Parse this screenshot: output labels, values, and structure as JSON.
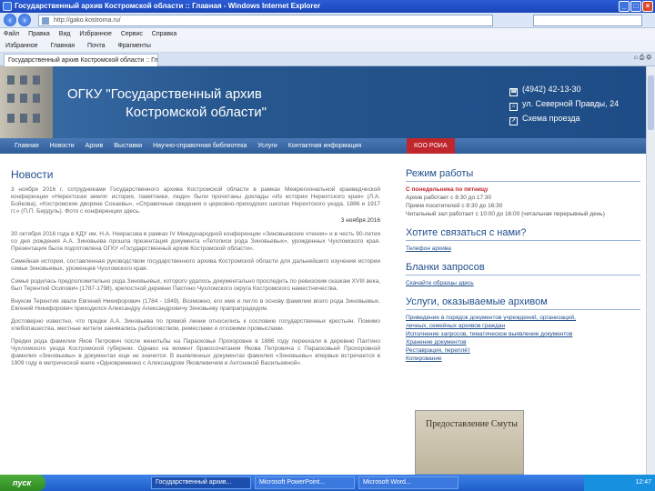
{
  "window": {
    "title": "Государственный архив Костромской области :: Главная - Windows Internet Explorer"
  },
  "address": {
    "url": "http://gako.kostroma.ru/"
  },
  "menu": [
    "Файл",
    "Правка",
    "Вид",
    "Избранное",
    "Сервис",
    "Справка"
  ],
  "favorites": [
    "Избранное",
    "Главная",
    "Почта",
    "Фрагменты"
  ],
  "tab": {
    "label": "Государственный архив Костромской области :: Гл..."
  },
  "site": {
    "title_line1": "ОГКУ \"Государственный архив",
    "title_line2": "Костромской области\"",
    "phone": "(4942) 42-13-30",
    "address": "ул. Северной Правды, 24",
    "map": "Схема проезда"
  },
  "nav": [
    "Главная",
    "Новости",
    "Архив",
    "Выставки",
    "Научно-справочная библиотека",
    "Услуги",
    "Контактная информация"
  ],
  "nav_special": "КОО РОИА",
  "news": {
    "heading": "Новости",
    "item1": "3 ноября 2016 г. сотрудниками Государственного архива Костромской области в рамках Межрегиональной краеведческой конференции «Нерехтская земля: история, памятники, люди» были прочитаны доклады «Из истории Нерехтского края» (Л.А. Бойкова), «Костромские дворяне Сокаевы», «Справочные сведения о церковно-приходских школах Нерехтского уезда. 1886 и 1917 гг.» (П.П. Бердуль). Фото с конференции здесь.",
    "date1": "3 ноября 2016",
    "item2": "30 октября 2016 года в КДУ им. Н.А. Некрасова в рамках IV Международной конференции «Зиновьевские чтения» и в честь 90-летия со дня рождения А.А. Зиновьева прошла презентация документа «Летописи рода Зиновьевых», урожденных Чухломского края. Презентация была подготовлена ОГКУ «Государственный архив Костромской области».",
    "item3": "Семейная история, составленная руководством государственного архива Костромской области для дальнейшего изучения истории семьи Зиновьевых, уроженцев Чухломского края.",
    "item4": "Семья родилась предположительно рода Зиновьевых, которого удалось документально проследить по ревизским сказкам XVIII века, был Терентий Осипович (1787-1798), крепостной деревни Пахтино Чухломского округа Костромского наместничества.",
    "item5": "Внуком Терентия звали Евгений Никифорович (1784 - 1849). Возможно, его имя и легло в основу фамилии всего рода Зиновьевых. Евгений Никифорович приходился Александру Александровичу Зиновьеву прапрапрадедом.",
    "item6": "Достоверно известно, что предки А.А. Зиновьева по прямой линии относились к сословию государственных крестьян. Помимо хлебопашества, местные жители занимались рыболовством, ремеслами и отхожими промыслами.",
    "item7": "Предки рода фамилии Яков Петрович после женитьбы на Парасковье Прохоровне в 1886 году переехали в деревню Пахтино Чухломского уезда Костромской губернии. Однако на момент бракосочетания Якова Петровича с Парасковьей Прохоровной фамилия «Зиновьевы» в документах еще не значится. В выявленных документах фамилия «Зиновьевы» впервые встречается в 1909 году в метрической книге «Одновременно с Александром Яковлевичем и Антониной Васильевной»."
  },
  "sidebar": {
    "hours_heading": "Режим работы",
    "hours_days": "С понедельника по пятницу",
    "hours_archive": "Архив работает с 8:30 до 17:30",
    "hours_visitors": "Прием посетителей с 8:30 до 16:30",
    "hours_reading": "Читальный зал работает с 10:00 до 16:00 (читальная перерывный день)",
    "contact_heading": "Хотите связаться с нами?",
    "contact_link": "Телефон архива",
    "forms_heading": "Бланки запросов",
    "forms_link": "Скачайте образцы здесь",
    "services_heading": "Услуги, оказываемые архивом",
    "services": [
      "Приведение в порядок документов учреждений, организаций,",
      "личных, семейных архивов граждан",
      "Исполнение запросов, тематическое выявление документов",
      "Хранение документов",
      "Реставрация, переплёт",
      "Копирование"
    ],
    "book_title": "Предоставление Смуты"
  },
  "taskbar": {
    "start": "пуск",
    "tasks": [
      "Государственный архив...",
      "Microsoft PowerPoint...",
      "Microsoft Word..."
    ],
    "clock": "12:47"
  },
  "colors": {
    "brand_blue": "#1f4e8c",
    "accent_red": "#c0272d"
  }
}
